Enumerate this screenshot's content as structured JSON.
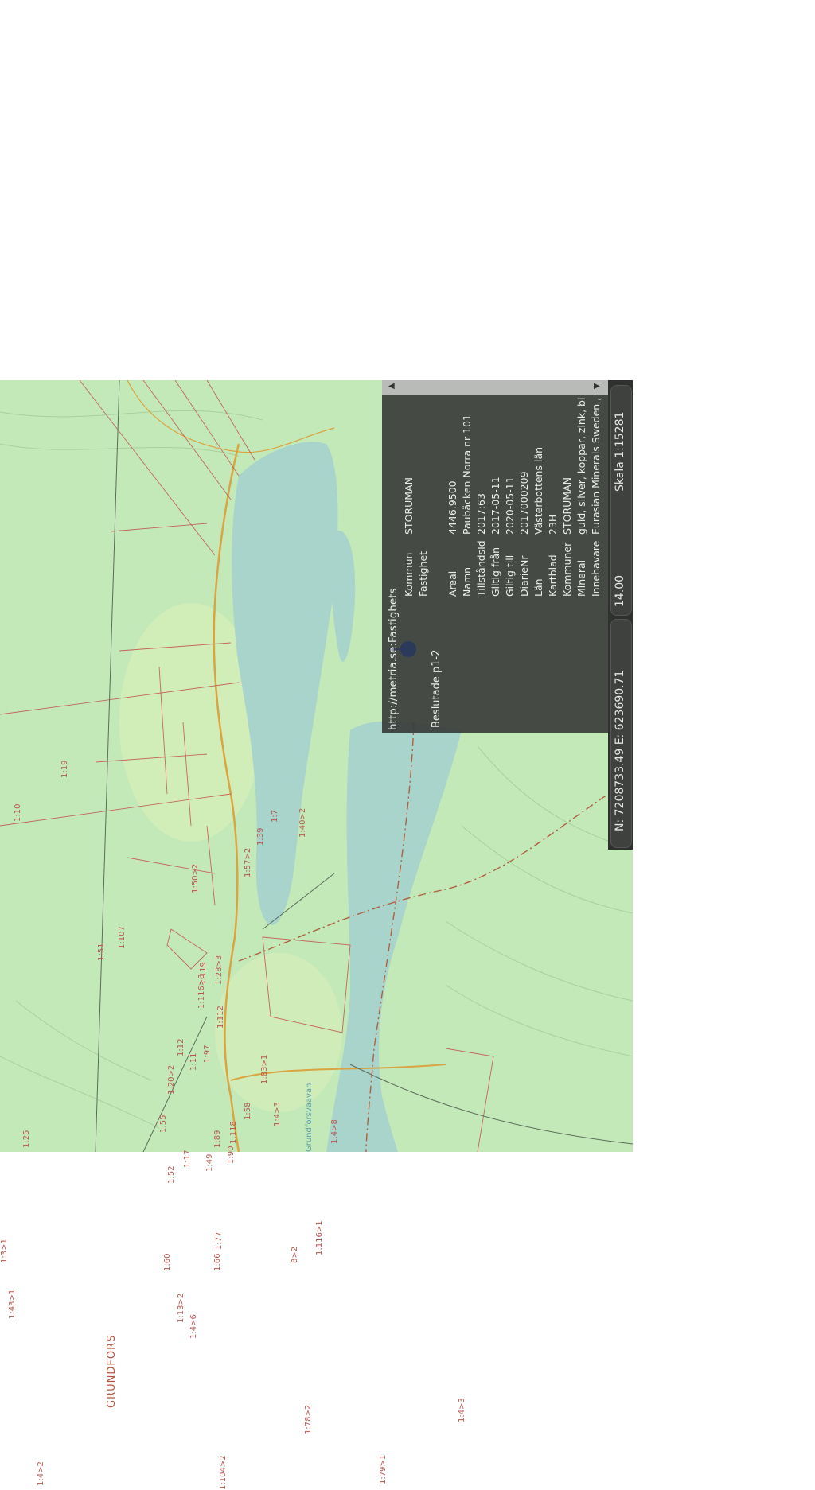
{
  "popup": {
    "url": "http://metria.se:Fastighets",
    "subtitle": "Beslutade p1-2",
    "rows": [
      {
        "key": "Kommun",
        "value": "STORUMAN"
      },
      {
        "key": "Fastighet",
        "value": ""
      },
      {
        "key": "Areal",
        "value": "4446.9500"
      },
      {
        "key": "Namn",
        "value": "Paubäcken Norra nr 101"
      },
      {
        "key": "TillståndsId",
        "value": "2017:63"
      },
      {
        "key": "Giltig från",
        "value": "2017-05-11"
      },
      {
        "key": "Giltig till",
        "value": "2020-05-11"
      },
      {
        "key": "DiarieNr",
        "value": "2017000209"
      },
      {
        "key": "Län",
        "value": "Västerbottens län"
      },
      {
        "key": "Kartblad",
        "value": "23H"
      },
      {
        "key": "Kommuner",
        "value": "STORUMAN"
      },
      {
        "key": "Mineral",
        "value": "guld, silver, koppar, zink, bl"
      },
      {
        "key": "Innehavare",
        "value": "Eurasian Minerals Sweden ,"
      }
    ]
  },
  "status": {
    "coords": "N: 7208733.49 E: 623690.71",
    "zoom": "14.00",
    "scale": "Skala 1:15281"
  },
  "map": {
    "place_label": "GRUNDFORS",
    "lake_label": "Grundforsvaavan",
    "parcel_labels": [
      "1:10",
      "1:19",
      "1:51",
      "1:107",
      "1:50>2",
      "1:57>2",
      "1:119",
      "1:28>3",
      "1:116>3",
      "1:112",
      "1:12",
      "1:11",
      "1:97",
      "1:20>2",
      "1:25",
      "1:55",
      "1:52",
      "1:17",
      "1:49",
      "1:89",
      "1:90",
      "1:118",
      "1:58",
      "1:83>1",
      "1:4>3",
      "1:4>8",
      "1:60",
      "1:66",
      "1:77",
      "1:3>1",
      "1:43>1",
      "1:13>2",
      "1:4>6",
      "1:116>1",
      "8>2",
      "1:78>2",
      "1:4>2",
      "1:104>2",
      "1:79>1",
      "1:4>3",
      "1:39",
      "1:40>2",
      "1:7"
    ],
    "colors": {
      "land": "#c4e9b8",
      "water": "#a8d4cc",
      "boundary": "#c0504d",
      "road": "#d9a441"
    }
  }
}
